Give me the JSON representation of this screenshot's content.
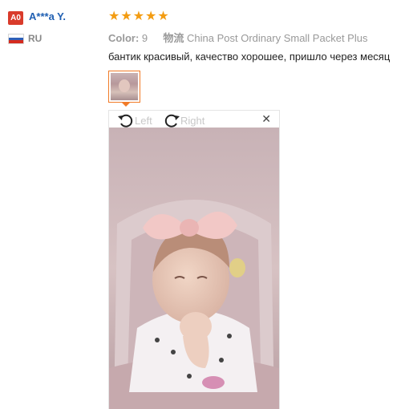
{
  "reviewer": {
    "badge": "A0",
    "name": "A***a Y.",
    "country_code": "RU"
  },
  "rating": {
    "stars_filled": 5,
    "stars_total": 5,
    "star_color": "#f39c12"
  },
  "attributes": {
    "color_label": "Color:",
    "color_value": "9",
    "shipping_label": "物流",
    "shipping_value": "China Post Ordinary Small Packet Plus"
  },
  "review_text": "бантик красивый, качество хорошее, пришло через месяц",
  "viewer": {
    "rotate_left_label": "Left",
    "rotate_right_label": "Right",
    "close_icon": "close-icon"
  },
  "colors": {
    "accent": "#f17b28",
    "username": "#1f5fb2",
    "badge": "#d93b2b"
  }
}
